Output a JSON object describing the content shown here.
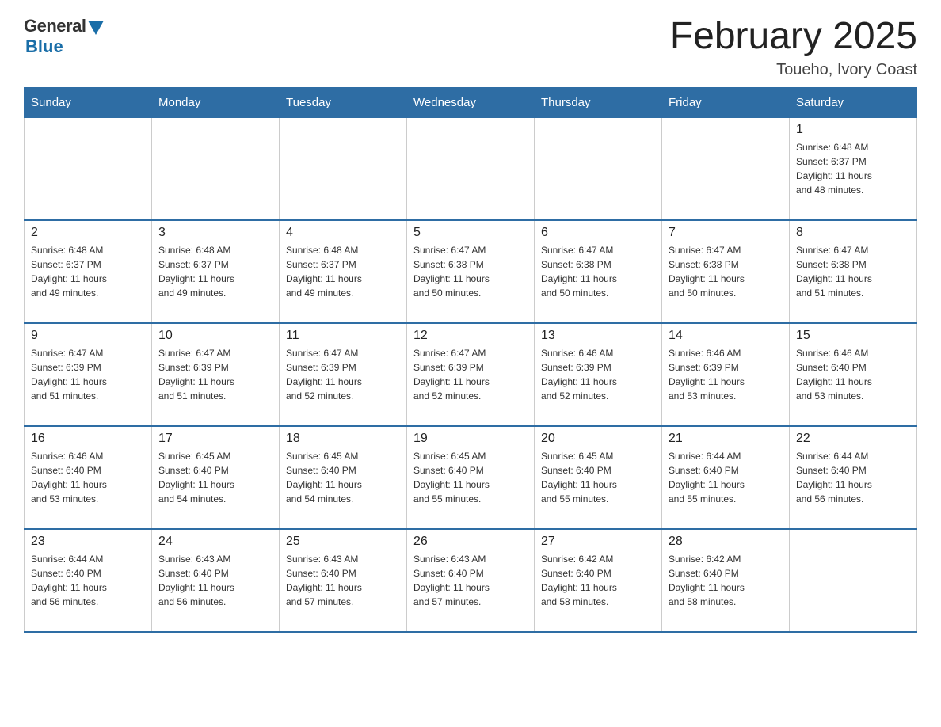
{
  "logo": {
    "general": "General",
    "blue": "Blue"
  },
  "title": "February 2025",
  "location": "Toueho, Ivory Coast",
  "weekdays": [
    "Sunday",
    "Monday",
    "Tuesday",
    "Wednesday",
    "Thursday",
    "Friday",
    "Saturday"
  ],
  "weeks": [
    [
      {
        "day": "",
        "info": ""
      },
      {
        "day": "",
        "info": ""
      },
      {
        "day": "",
        "info": ""
      },
      {
        "day": "",
        "info": ""
      },
      {
        "day": "",
        "info": ""
      },
      {
        "day": "",
        "info": ""
      },
      {
        "day": "1",
        "info": "Sunrise: 6:48 AM\nSunset: 6:37 PM\nDaylight: 11 hours\nand 48 minutes."
      }
    ],
    [
      {
        "day": "2",
        "info": "Sunrise: 6:48 AM\nSunset: 6:37 PM\nDaylight: 11 hours\nand 49 minutes."
      },
      {
        "day": "3",
        "info": "Sunrise: 6:48 AM\nSunset: 6:37 PM\nDaylight: 11 hours\nand 49 minutes."
      },
      {
        "day": "4",
        "info": "Sunrise: 6:48 AM\nSunset: 6:37 PM\nDaylight: 11 hours\nand 49 minutes."
      },
      {
        "day": "5",
        "info": "Sunrise: 6:47 AM\nSunset: 6:38 PM\nDaylight: 11 hours\nand 50 minutes."
      },
      {
        "day": "6",
        "info": "Sunrise: 6:47 AM\nSunset: 6:38 PM\nDaylight: 11 hours\nand 50 minutes."
      },
      {
        "day": "7",
        "info": "Sunrise: 6:47 AM\nSunset: 6:38 PM\nDaylight: 11 hours\nand 50 minutes."
      },
      {
        "day": "8",
        "info": "Sunrise: 6:47 AM\nSunset: 6:38 PM\nDaylight: 11 hours\nand 51 minutes."
      }
    ],
    [
      {
        "day": "9",
        "info": "Sunrise: 6:47 AM\nSunset: 6:39 PM\nDaylight: 11 hours\nand 51 minutes."
      },
      {
        "day": "10",
        "info": "Sunrise: 6:47 AM\nSunset: 6:39 PM\nDaylight: 11 hours\nand 51 minutes."
      },
      {
        "day": "11",
        "info": "Sunrise: 6:47 AM\nSunset: 6:39 PM\nDaylight: 11 hours\nand 52 minutes."
      },
      {
        "day": "12",
        "info": "Sunrise: 6:47 AM\nSunset: 6:39 PM\nDaylight: 11 hours\nand 52 minutes."
      },
      {
        "day": "13",
        "info": "Sunrise: 6:46 AM\nSunset: 6:39 PM\nDaylight: 11 hours\nand 52 minutes."
      },
      {
        "day": "14",
        "info": "Sunrise: 6:46 AM\nSunset: 6:39 PM\nDaylight: 11 hours\nand 53 minutes."
      },
      {
        "day": "15",
        "info": "Sunrise: 6:46 AM\nSunset: 6:40 PM\nDaylight: 11 hours\nand 53 minutes."
      }
    ],
    [
      {
        "day": "16",
        "info": "Sunrise: 6:46 AM\nSunset: 6:40 PM\nDaylight: 11 hours\nand 53 minutes."
      },
      {
        "day": "17",
        "info": "Sunrise: 6:45 AM\nSunset: 6:40 PM\nDaylight: 11 hours\nand 54 minutes."
      },
      {
        "day": "18",
        "info": "Sunrise: 6:45 AM\nSunset: 6:40 PM\nDaylight: 11 hours\nand 54 minutes."
      },
      {
        "day": "19",
        "info": "Sunrise: 6:45 AM\nSunset: 6:40 PM\nDaylight: 11 hours\nand 55 minutes."
      },
      {
        "day": "20",
        "info": "Sunrise: 6:45 AM\nSunset: 6:40 PM\nDaylight: 11 hours\nand 55 minutes."
      },
      {
        "day": "21",
        "info": "Sunrise: 6:44 AM\nSunset: 6:40 PM\nDaylight: 11 hours\nand 55 minutes."
      },
      {
        "day": "22",
        "info": "Sunrise: 6:44 AM\nSunset: 6:40 PM\nDaylight: 11 hours\nand 56 minutes."
      }
    ],
    [
      {
        "day": "23",
        "info": "Sunrise: 6:44 AM\nSunset: 6:40 PM\nDaylight: 11 hours\nand 56 minutes."
      },
      {
        "day": "24",
        "info": "Sunrise: 6:43 AM\nSunset: 6:40 PM\nDaylight: 11 hours\nand 56 minutes."
      },
      {
        "day": "25",
        "info": "Sunrise: 6:43 AM\nSunset: 6:40 PM\nDaylight: 11 hours\nand 57 minutes."
      },
      {
        "day": "26",
        "info": "Sunrise: 6:43 AM\nSunset: 6:40 PM\nDaylight: 11 hours\nand 57 minutes."
      },
      {
        "day": "27",
        "info": "Sunrise: 6:42 AM\nSunset: 6:40 PM\nDaylight: 11 hours\nand 58 minutes."
      },
      {
        "day": "28",
        "info": "Sunrise: 6:42 AM\nSunset: 6:40 PM\nDaylight: 11 hours\nand 58 minutes."
      },
      {
        "day": "",
        "info": ""
      }
    ]
  ]
}
